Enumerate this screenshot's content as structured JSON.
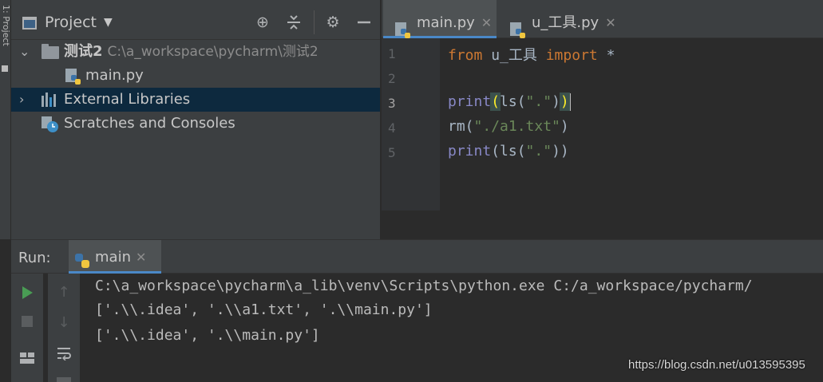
{
  "left_strip": {
    "label": "1: Project"
  },
  "project_panel": {
    "title": "Project",
    "tree": {
      "project_name": "测试2",
      "project_path": "C:\\a_workspace\\pycharm\\测试2",
      "file": "main.py",
      "external_libraries": "External Libraries",
      "scratches": "Scratches and Consoles"
    }
  },
  "editor": {
    "tabs": [
      {
        "label": "main.py",
        "active": true
      },
      {
        "label": "u_工具.py",
        "active": false
      }
    ],
    "line_numbers": [
      "1",
      "2",
      "3",
      "4",
      "5"
    ],
    "code": {
      "line1_kw_from": "from",
      "line1_module": " u_工具 ",
      "line1_kw_import": "import",
      "line1_star": " *",
      "line3_print": "print",
      "line3_open": "(",
      "line3_ls": "ls(",
      "line3_str": "\".\"",
      "line3_close1": ")",
      "line3_close2": ")",
      "line4_rm": "rm(",
      "line4_str": "\"./a1.txt\"",
      "line4_close": ")",
      "line5_print": "print",
      "line5_rest": "(ls(",
      "line5_str": "\".\"",
      "line5_close": "))"
    }
  },
  "run_panel": {
    "label": "Run:",
    "tab": "main",
    "console_lines": [
      "C:\\a_workspace\\pycharm\\a_lib\\venv\\Scripts\\python.exe C:/a_workspace/pycharm/",
      "['.\\\\.idea', '.\\\\a1.txt', '.\\\\main.py']",
      "['.\\\\.idea', '.\\\\main.py']"
    ]
  },
  "watermark": "https://blog.csdn.net/u013595395",
  "colors": {
    "accent": "#4a88c7",
    "keyword": "#cc7832",
    "builtin": "#8888c6",
    "string": "#6a8759",
    "run_green": "#499c54"
  }
}
